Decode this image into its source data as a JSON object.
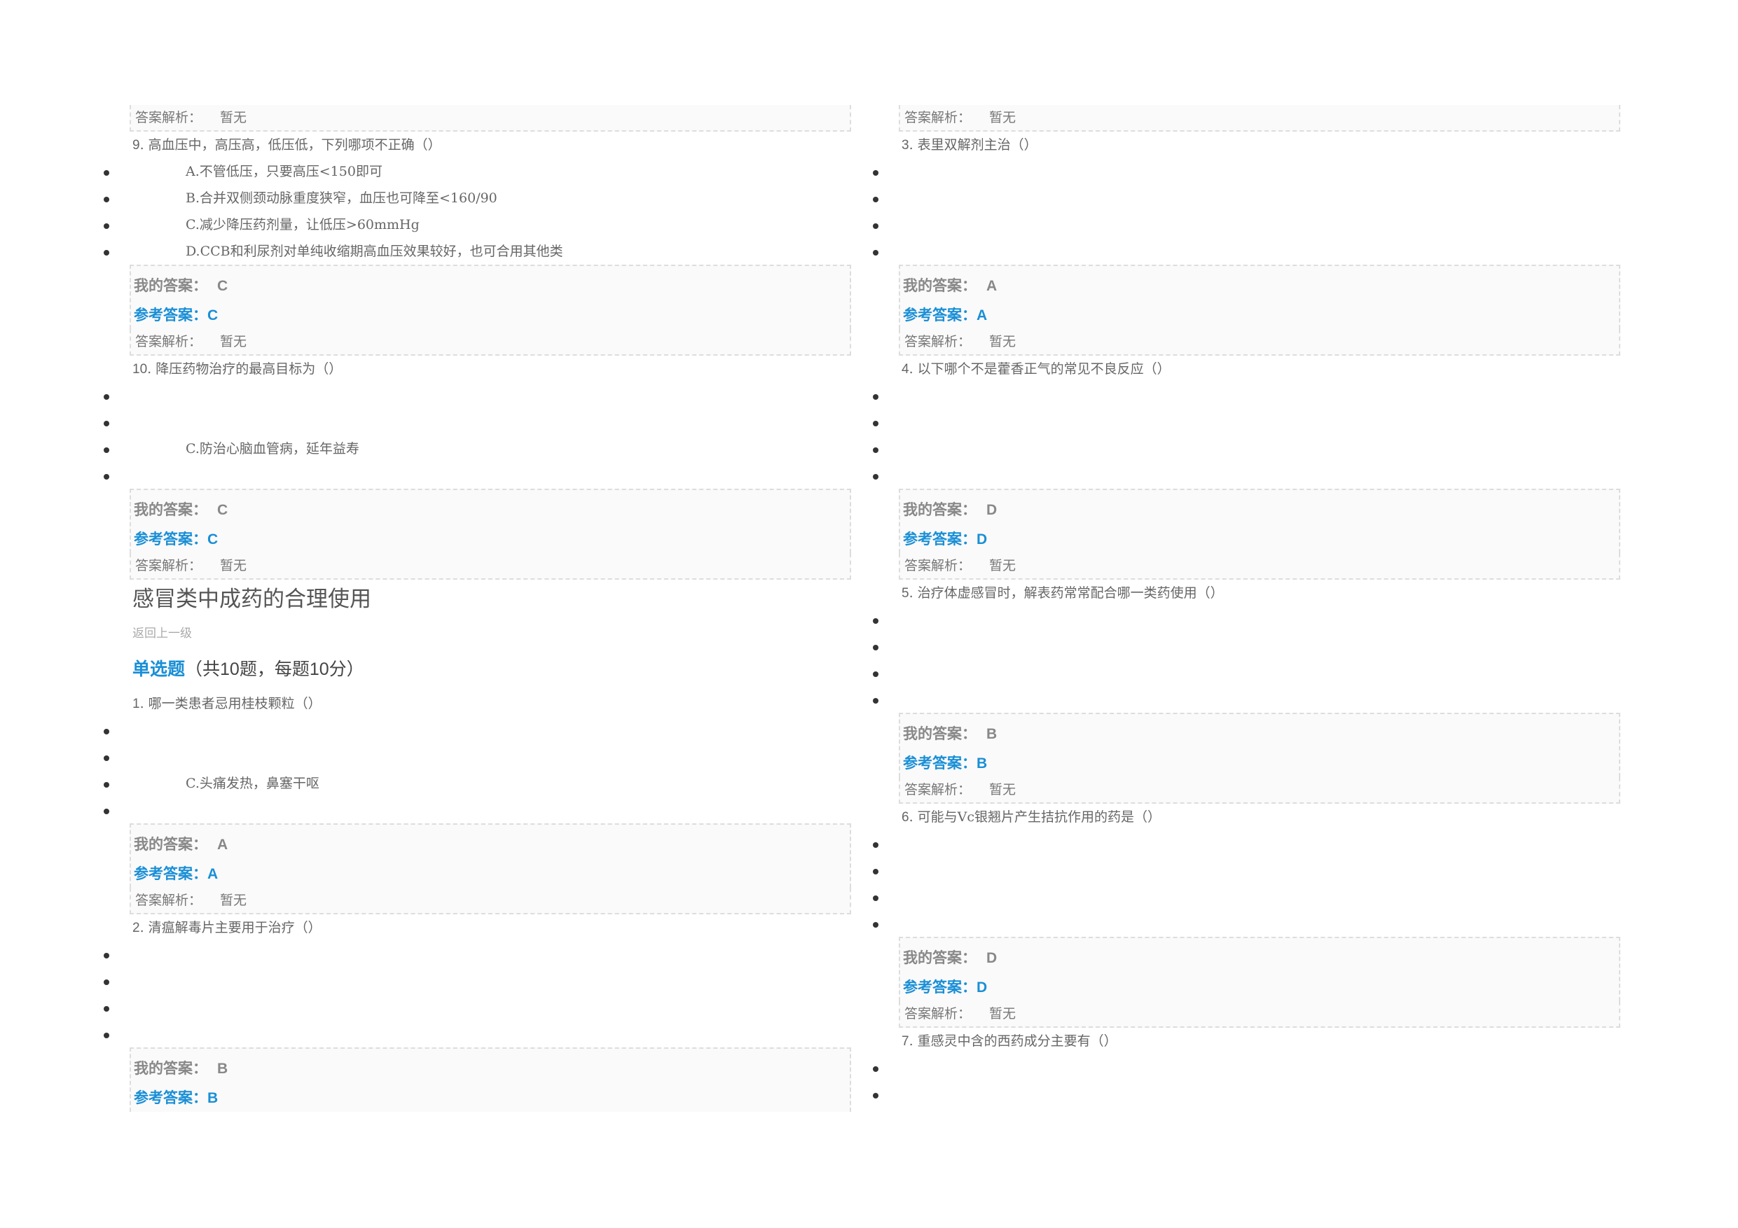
{
  "labels": {
    "explain": "答案解析：",
    "explain_value": "暂无",
    "my_answer": "我的答案：",
    "ref_answer": "参考答案："
  },
  "section": {
    "title": "感冒类中成药的合理使用",
    "back": "返回上一级",
    "type_label": "单选题",
    "type_detail": "（共10题，每题10分）"
  },
  "left": {
    "q9": {
      "num": "9",
      "text": ". 高血压中，高压高，低压低，下列哪项不正确（）",
      "options": [
        "A.不管低压，只要高压<150即可",
        "B.合并双侧颈动脉重度狭窄，血压也可降至<160/90",
        "C.减少降压药剂量，让低压>60mmHg",
        "D.CCB和利尿剂对单纯收缩期高血压效果较好，也可合用其他类"
      ],
      "mine": "C",
      "ref": "C"
    },
    "q10": {
      "num": "10",
      "text": ". 降压药物治疗的最高目标为（）",
      "options": [
        "",
        "",
        "C.防治心脑血管病，延年益寿",
        ""
      ],
      "mine": "C",
      "ref": "C"
    },
    "s1": {
      "num": "1",
      "text": ". 哪一类患者忌用桂枝颗粒（）",
      "options": [
        "",
        "",
        "C.头痛发热，鼻塞干呕",
        ""
      ],
      "mine": "A",
      "ref": "A"
    },
    "s2": {
      "num": "2",
      "text": ". 清瘟解毒片主要用于治疗（）",
      "options": [
        "",
        "",
        "",
        ""
      ],
      "mine": "B",
      "ref": "B"
    }
  },
  "right": {
    "s3": {
      "num": "3",
      "text": ". 表里双解剂主治（）",
      "options": [
        "",
        "",
        "",
        ""
      ],
      "mine": "A",
      "ref": "A"
    },
    "s4": {
      "num": "4",
      "text": ". 以下哪个不是藿香正气的常见不良反应（）",
      "options": [
        "",
        "",
        "",
        ""
      ],
      "mine": "D",
      "ref": "D"
    },
    "s5": {
      "num": "5",
      "text": ". 治疗体虚感冒时，解表药常常配合哪一类药使用（）",
      "options": [
        "",
        "",
        "",
        ""
      ],
      "mine": "B",
      "ref": "B"
    },
    "s6": {
      "num": "6",
      "text": ". 可能与Vc银翘片产生拮抗作用的药是（）",
      "options": [
        "",
        "",
        "",
        ""
      ],
      "mine": "D",
      "ref": "D"
    },
    "s7": {
      "num": "7",
      "text": ". 重感灵中含的西药成分主要有（）",
      "options": [
        "",
        ""
      ]
    }
  }
}
